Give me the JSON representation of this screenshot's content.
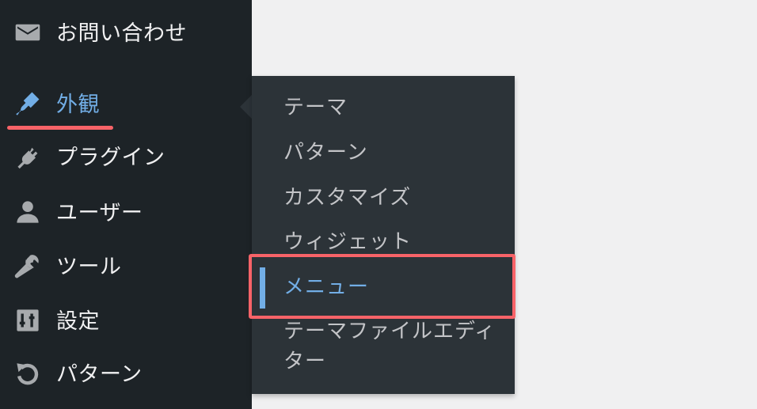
{
  "sidebar": {
    "items": [
      {
        "label": "お問い合わせ",
        "icon": "mail-icon"
      },
      {
        "label": "外観",
        "icon": "paintbrush-icon",
        "active": true
      },
      {
        "label": "プラグイン",
        "icon": "plugin-icon"
      },
      {
        "label": "ユーザー",
        "icon": "user-icon"
      },
      {
        "label": "ツール",
        "icon": "wrench-icon"
      },
      {
        "label": "設定",
        "icon": "settings-icon"
      },
      {
        "label": "パターン",
        "icon": "undo-icon"
      }
    ]
  },
  "submenu": {
    "items": [
      {
        "label": "テーマ"
      },
      {
        "label": "パターン"
      },
      {
        "label": "カスタマイズ"
      },
      {
        "label": "ウィジェット"
      },
      {
        "label": "メニュー",
        "current": true
      },
      {
        "label": "テーマファイルエディター"
      }
    ]
  },
  "colors": {
    "sidebar_bg": "#1d2327",
    "flyout_bg": "#2c3338",
    "accent": "#72aee6",
    "annotation": "#f86368",
    "content_bg": "#f0f0f1"
  }
}
